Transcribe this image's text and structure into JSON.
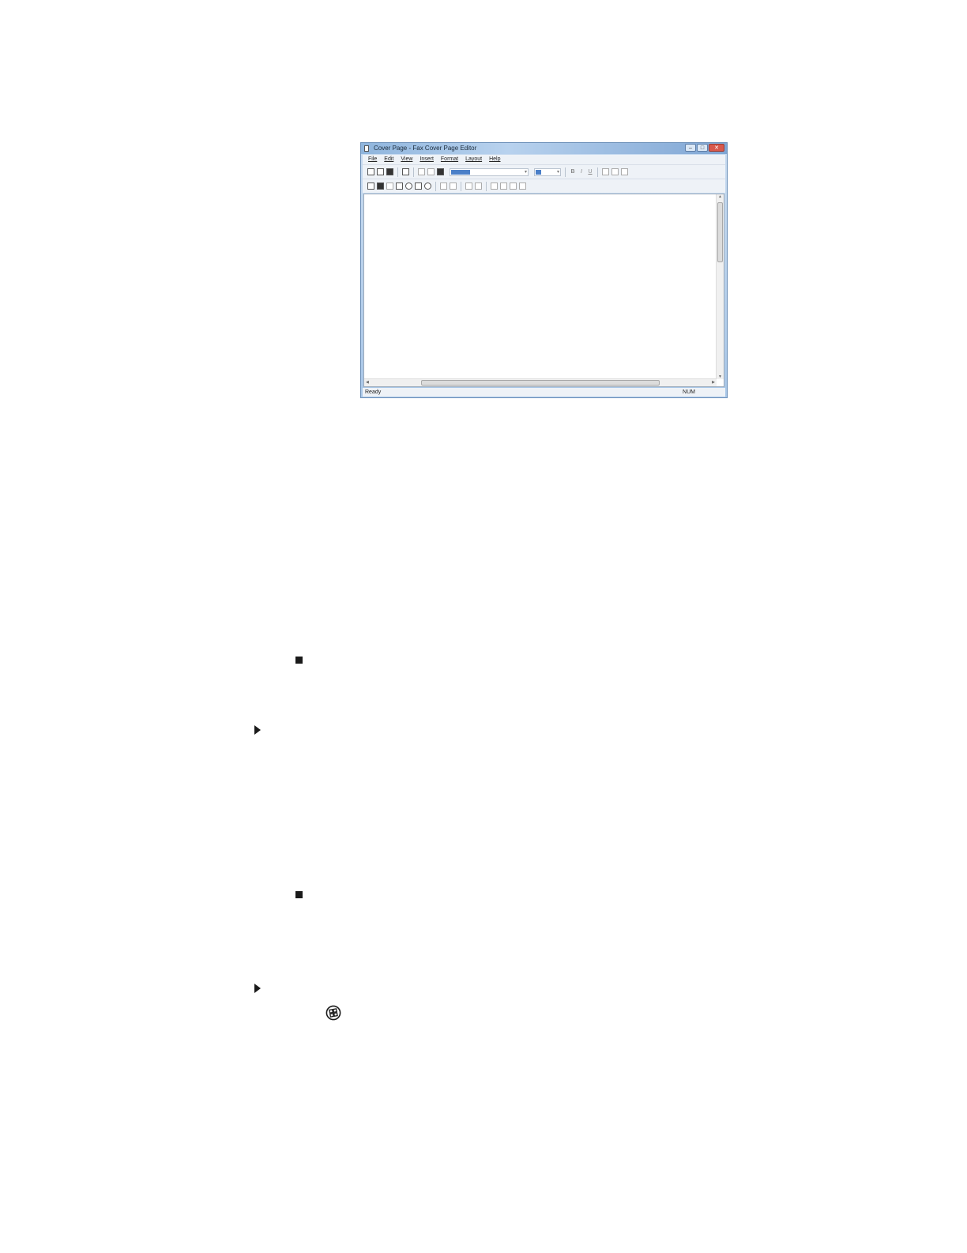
{
  "window": {
    "title": "Cover Page - Fax Cover Page Editor",
    "controls": {
      "minimize": "–",
      "maximize": "□",
      "close": "✕"
    }
  },
  "menu": [
    "File",
    "Edit",
    "View",
    "Insert",
    "Format",
    "Layout",
    "Help"
  ],
  "toolbar_formatting": {
    "font_combo_arrow": "▾",
    "size_combo_arrow": "▾",
    "bold": "B",
    "italic": "I",
    "underline": "U"
  },
  "scroll_arrows": {
    "up": "▲",
    "down": "▼",
    "left": "◀",
    "right": "▶"
  },
  "status": {
    "left": "Ready",
    "right": "NUM"
  },
  "icons": {
    "bullet": "square-bullet-icon",
    "step": "triangle-arrow-icon",
    "start": "windows-start-icon"
  }
}
